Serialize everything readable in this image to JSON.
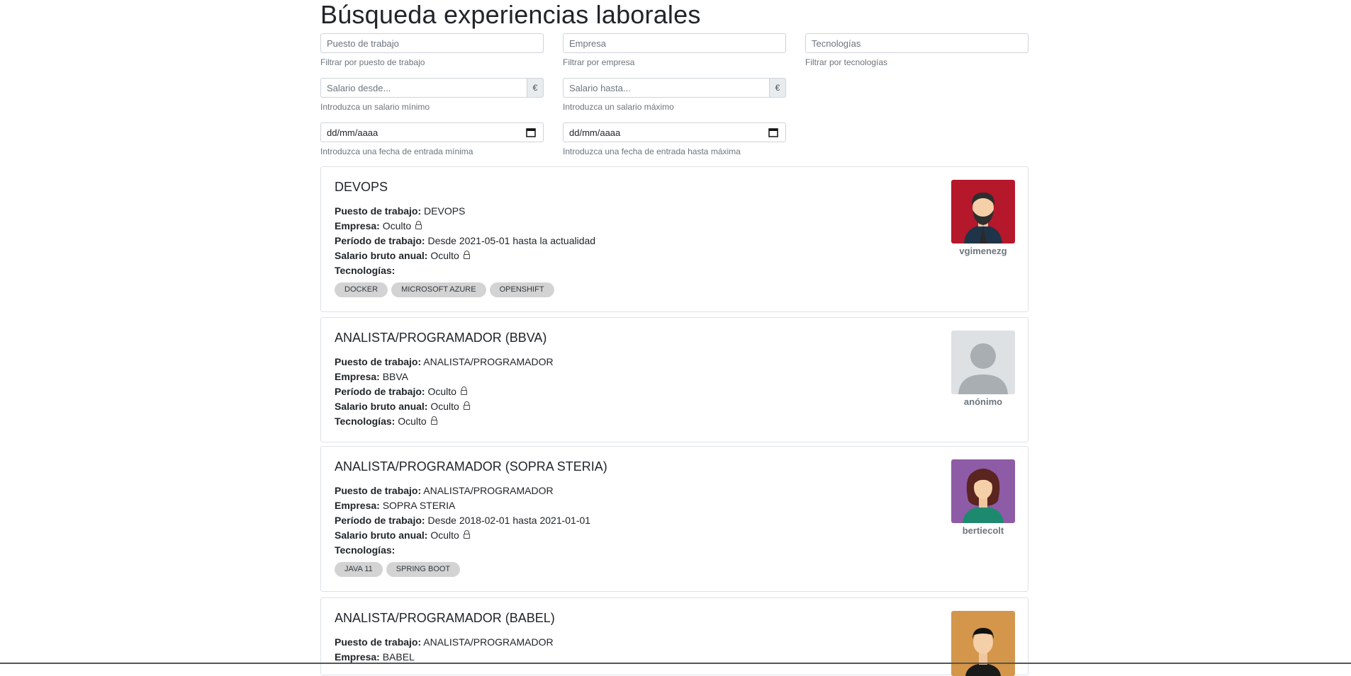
{
  "page": {
    "title": "Búsqueda experiencias laborales"
  },
  "filters": {
    "puesto": {
      "placeholder": "Puesto de trabajo",
      "help": "Filtrar por puesto de trabajo"
    },
    "empresa": {
      "placeholder": "Empresa",
      "help": "Filtrar por empresa"
    },
    "tecnologias": {
      "placeholder": "Tecnologías",
      "help": "Filtrar por tecnologías"
    },
    "salario_desde": {
      "placeholder": "Salario desde...",
      "addon": "€",
      "help": "Introduzca un salario mínimo"
    },
    "salario_hasta": {
      "placeholder": "Salario hasta...",
      "addon": "€",
      "help": "Introduzca un salario máximo"
    },
    "fecha_desde": {
      "value": "dd/mm/aaaa",
      "help": "Introduzca una fecha de entrada mínima"
    },
    "fecha_hasta": {
      "value": "dd/mm/aaaa",
      "help": "Introduzca una fecha de entrada hasta máxima"
    }
  },
  "labels": {
    "puesto": "Puesto de trabajo:",
    "empresa": "Empresa:",
    "periodo": "Período de trabajo:",
    "salario": "Salario bruto anual:",
    "tecnologias": "Tecnologías:"
  },
  "cards": [
    {
      "title": "DEVOPS",
      "puesto": "DEVOPS",
      "empresa": "Oculto",
      "periodo": "Desde 2021-05-01 hasta la actualidad",
      "salario": "Oculto",
      "tags": [
        "DOCKER",
        "MICROSOFT AZURE",
        "OPENSHIFT"
      ],
      "user": "vgimenezg",
      "avatar_color": "#b5172b",
      "avatar_icon": "bearded-man-avatar"
    },
    {
      "title": "ANALISTA/PROGRAMADOR (BBVA)",
      "puesto": "ANALISTA/PROGRAMADOR",
      "empresa": "BBVA",
      "periodo": "Oculto",
      "salario": "Oculto",
      "tecnologias": "Oculto",
      "user": "anónimo",
      "avatar_color": "#dee1e3",
      "avatar_icon": "anonymous-user-avatar"
    },
    {
      "title": "ANALISTA/PROGRAMADOR (SOPRA STERIA)",
      "puesto": "ANALISTA/PROGRAMADOR",
      "empresa": "SOPRA STERIA",
      "periodo": "Desde 2018-02-01 hasta 2021-01-01",
      "salario": "Oculto",
      "tags": [
        "JAVA 11",
        "SPRING BOOT"
      ],
      "user": "bertiecolt",
      "avatar_color": "#8e5ba6",
      "avatar_icon": "curly-hair-woman-avatar"
    },
    {
      "title": "ANALISTA/PROGRAMADOR (BABEL)",
      "puesto": "ANALISTA/PROGRAMADOR",
      "empresa": "BABEL",
      "avatar_color": "#d4964a",
      "avatar_icon": "man-avatar"
    }
  ]
}
